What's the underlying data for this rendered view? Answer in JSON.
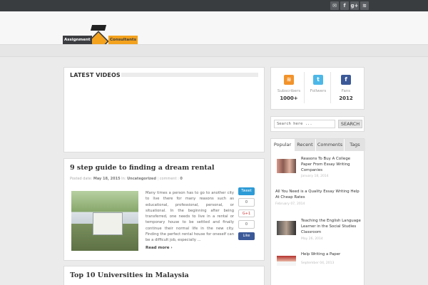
{
  "social": [
    "✉",
    "f",
    "g+",
    "≋"
  ],
  "logo": {
    "left": "Assignment",
    "right": "Consultants"
  },
  "latest_videos": {
    "title": "LATEST VIDEOS"
  },
  "post1": {
    "title": "9 step guide to finding a dream rental",
    "meta_prefix": "Posted date:",
    "date": "May 18, 2015",
    "in_label": "In:",
    "category": "Uncategorized",
    "comment_label": "comment :",
    "comments": "0",
    "excerpt": "Many times a person has to go to another city to live there for many reasons such as educational, professional, personal, or situational. In the beginning after being transferred, one needs to live in a rental or temporary house to be settled and finally continue their normal life in the new city. Finding the perfect rental house for oneself can be a difficult job, especially ...",
    "read_more": "Read more ›",
    "tweet": "Tweet",
    "count": "0",
    "gplus": "G+1",
    "count2": "0",
    "like": "Like"
  },
  "post2": {
    "title": "Top 10 Universities in Malaysia"
  },
  "stats": [
    {
      "label": "Subscribers",
      "value": "1000+",
      "icon": "rss-icon",
      "color": "#f2932b",
      "glyph": "≋"
    },
    {
      "label": "Follwers",
      "value": "",
      "icon": "twitter-icon",
      "color": "#4cb8e8",
      "glyph": "t"
    },
    {
      "label": "Fans",
      "value": "2012",
      "icon": "facebook-icon",
      "color": "#3b5998",
      "glyph": "f"
    }
  ],
  "search": {
    "placeholder": "Search here ...",
    "button": "SEARCH"
  },
  "tabs": [
    "Popular",
    "Recent",
    "Comments",
    "Tags"
  ],
  "popular": [
    {
      "title": "Reasons To Buy A College Paper From Essay Writing Companies",
      "date": "January 18, 2014"
    },
    {
      "title": "All You Need is a Quality Essay Writing Help At Cheap Rates",
      "date": "February 07, 2014"
    },
    {
      "title": "Teaching the English Language Learner in the Social Studies Classroom",
      "date": "May 26, 2014"
    },
    {
      "title": "Help Writing a Paper",
      "date": "September 04, 2013"
    }
  ]
}
